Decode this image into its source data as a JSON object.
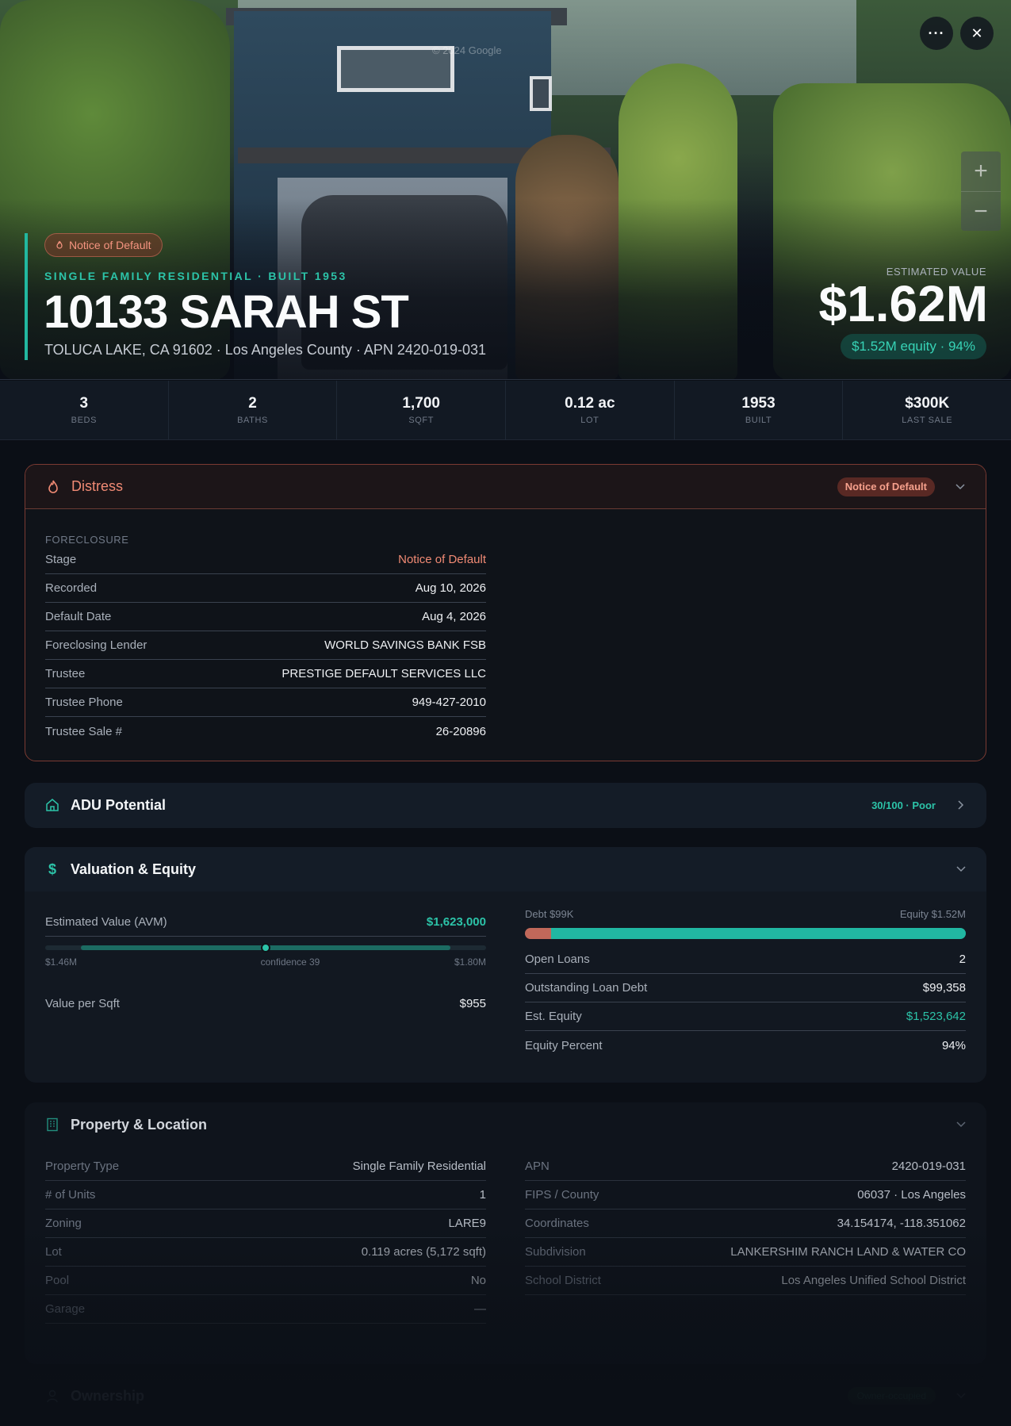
{
  "hero": {
    "watermark": "© 2024 Google",
    "badge": "Notice of Default",
    "subtype": "SINGLE FAMILY RESIDENTIAL · BUILT 1953",
    "address": "10133 SARAH ST",
    "location": "TOLUCA LAKE, CA 91602 · Los Angeles County · APN 2420-019-031",
    "estimated_label": "ESTIMATED VALUE",
    "estimated_value": "$1.62M",
    "equity_pill": "$1.52M equity · 94%",
    "more_icon": "···",
    "close_icon": "✕",
    "zoom_in": "+",
    "zoom_out": "−"
  },
  "stats": [
    {
      "value": "3",
      "label": "BEDS"
    },
    {
      "value": "2",
      "label": "BATHS"
    },
    {
      "value": "1,700",
      "label": "SQFT"
    },
    {
      "value": "0.12 ac",
      "label": "LOT"
    },
    {
      "value": "1953",
      "label": "BUILT"
    },
    {
      "value": "$300K",
      "label": "LAST SALE"
    }
  ],
  "distress": {
    "title": "Distress",
    "badge": "Notice of Default",
    "section": "FORECLOSURE",
    "rows": [
      {
        "k": "Stage",
        "v": "Notice of Default"
      },
      {
        "k": "Recorded",
        "v": "Aug 10, 2026"
      },
      {
        "k": "Default Date",
        "v": "Aug 4, 2026"
      },
      {
        "k": "Foreclosing Lender",
        "v": "WORLD SAVINGS BANK FSB"
      },
      {
        "k": "Trustee",
        "v": "PRESTIGE DEFAULT SERVICES LLC"
      },
      {
        "k": "Trustee Phone",
        "v": "949-427-2010"
      },
      {
        "k": "Trustee Sale #",
        "v": "26-20896"
      }
    ]
  },
  "adu": {
    "title": "ADU Potential",
    "score": "30/100 · Poor"
  },
  "valuation": {
    "title": "Valuation & Equity",
    "avm_label": "Estimated Value (AVM)",
    "avm_value": "$1,623,000",
    "avm_low": "$1.46M",
    "avm_conf": "confidence 39",
    "avm_high": "$1.80M",
    "avm_fraction": 0.5,
    "value_per_sqft_label": "Value per Sqft",
    "value_per_sqft": "$955",
    "debt_label": "Debt $99K",
    "equity_label": "Equity $1.52M",
    "debt_fraction": 0.06,
    "rows": [
      {
        "k": "Open Loans",
        "v": "2"
      },
      {
        "k": "Outstanding Loan Debt",
        "v": "$99,358"
      },
      {
        "k": "Est. Equity",
        "v": "$1,523,642"
      },
      {
        "k": "Equity Percent",
        "v": "94%"
      }
    ]
  },
  "property": {
    "title": "Property & Location",
    "left": [
      {
        "k": "Property Type",
        "v": "Single Family Residential"
      },
      {
        "k": "# of Units",
        "v": "1"
      },
      {
        "k": "Zoning",
        "v": "LARE9"
      },
      {
        "k": "Lot",
        "v": "0.119 acres (5,172 sqft)"
      },
      {
        "k": "Pool",
        "v": "No"
      },
      {
        "k": "Garage",
        "v": "—"
      }
    ],
    "right": [
      {
        "k": "APN",
        "v": "2420-019-031"
      },
      {
        "k": "FIPS / County",
        "v": "06037 · Los Angeles"
      },
      {
        "k": "Coordinates",
        "v": "34.154174, -118.351062"
      },
      {
        "k": "Subdivision",
        "v": "LANKERSHIM RANCH LAND & WATER CO"
      },
      {
        "k": "School District",
        "v": "Los Angeles Unified School District"
      }
    ]
  },
  "ownership": {
    "title": "Ownership",
    "pill": "Owner-occupied"
  },
  "colors": {
    "accent": "#2cc3a8",
    "distress": "#f08a74",
    "debt": "#c0685a",
    "equity": "#21b7a2"
  }
}
